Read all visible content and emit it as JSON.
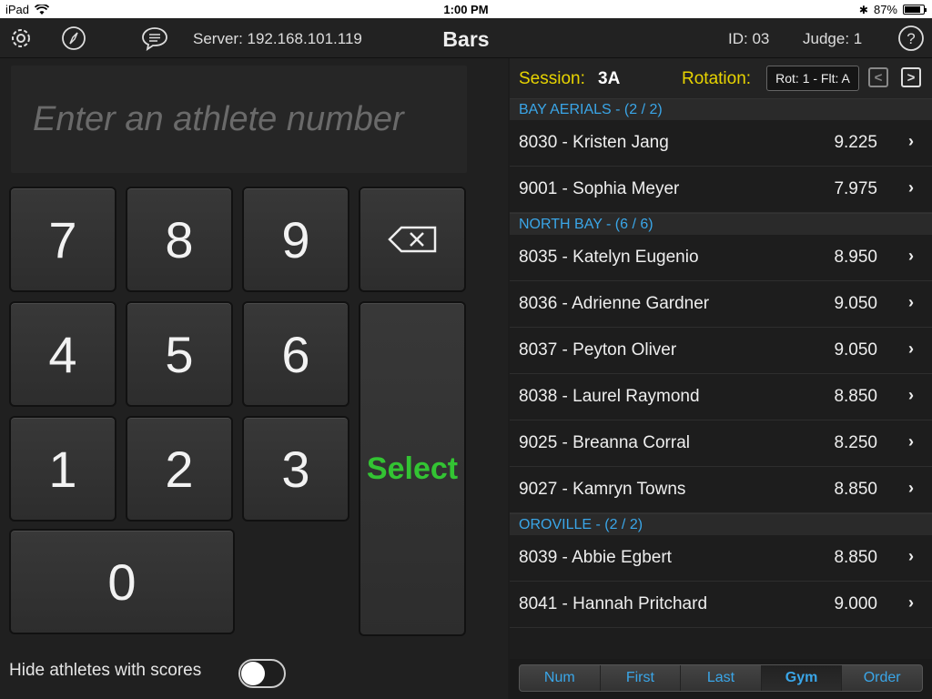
{
  "status_bar": {
    "device": "iPad",
    "time": "1:00 PM",
    "battery": "87%"
  },
  "header": {
    "server": "Server:  192.168.101.119",
    "title": "Bars",
    "id": "ID:  03",
    "judge": "Judge: 1"
  },
  "entry": {
    "placeholder": "Enter an athlete number"
  },
  "keypad": {
    "k7": "7",
    "k8": "8",
    "k9": "9",
    "k4": "4",
    "k5": "5",
    "k6": "6",
    "k1": "1",
    "k2": "2",
    "k3": "3",
    "k0": "0",
    "backspace": "⌫",
    "select": "Select"
  },
  "hide_label": "Hide athletes with scores",
  "hide_toggle": false,
  "session": {
    "label": "Session:",
    "value": "3A",
    "rotation_label": "Rotation:",
    "rotation_value": "Rot: 1 - Flt: A"
  },
  "groups": [
    {
      "name": "BAY AERIALS - (2 / 2)",
      "athletes": [
        {
          "label": "8030 - Kristen Jang",
          "score": "9.225"
        },
        {
          "label": "9001 - Sophia Meyer",
          "score": "7.975"
        }
      ]
    },
    {
      "name": "NORTH BAY - (6 / 6)",
      "athletes": [
        {
          "label": "8035 - Katelyn Eugenio",
          "score": "8.950"
        },
        {
          "label": "8036 - Adrienne Gardner",
          "score": "9.050"
        },
        {
          "label": "8037 - Peyton Oliver",
          "score": "9.050"
        },
        {
          "label": "8038 - Laurel Raymond",
          "score": "8.850"
        },
        {
          "label": "9025 - Breanna Corral",
          "score": "8.250"
        },
        {
          "label": "9027 - Kamryn Towns",
          "score": "8.850"
        }
      ]
    },
    {
      "name": "OROVILLE - (2 / 2)",
      "athletes": [
        {
          "label": "8039 - Abbie Egbert",
          "score": "8.850"
        },
        {
          "label": "8041 - Hannah Pritchard",
          "score": "9.000"
        }
      ]
    }
  ],
  "sort": {
    "options": [
      "Num",
      "First",
      "Last",
      "Gym",
      "Order"
    ],
    "selected": "Gym"
  }
}
